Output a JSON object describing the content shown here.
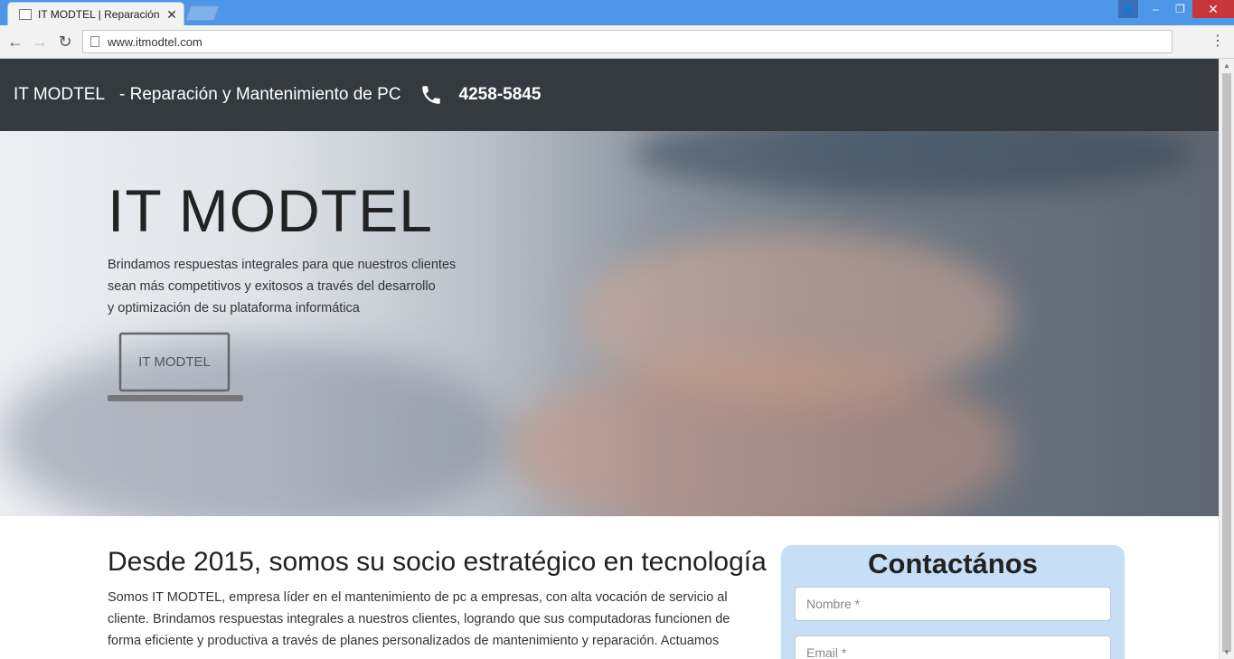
{
  "browser": {
    "tab_title": "IT MODTEL | Reparación",
    "tab_close": "✕",
    "url": "www.itmodtel.com",
    "back": "←",
    "forward": "→",
    "reload": "↻",
    "menu": "⋮",
    "minimize": "–",
    "restore": "❐",
    "close": "✕",
    "user": "👤"
  },
  "header": {
    "brand": "IT MODTEL",
    "tagline": "- Reparación y Mantenimiento de PC",
    "phone_icon": "phone-icon",
    "phone": "4258-5845"
  },
  "hero": {
    "title": "IT MODTEL",
    "lines": [
      "Brindamos respuestas integrales para que nuestros clientes",
      "sean más competitivos y exitosos a través del desarrollo",
      "y optimización de su plataforma informática"
    ],
    "logo_text": "IT MODTEL"
  },
  "about": {
    "title": "Desde 2015, somos su socio estratégico en tecnología",
    "lines": [
      "Somos IT MODTEL, empresa líder en el mantenimiento de pc a empresas, con alta vocación de servicio al",
      "cliente. Brindamos respuestas integrales a nuestros clientes, logrando que sus computadoras funcionen de",
      "forma eficiente y productiva a través de planes personalizados de mantenimiento y reparación. Actuamos"
    ]
  },
  "contact": {
    "title": "Contactános",
    "name_placeholder": "Nombre *",
    "email_placeholder": "Email *"
  },
  "colors": {
    "header_bg": "#343a40",
    "contact_bg": "#c6def6",
    "titlebar": "#4d96e8"
  }
}
